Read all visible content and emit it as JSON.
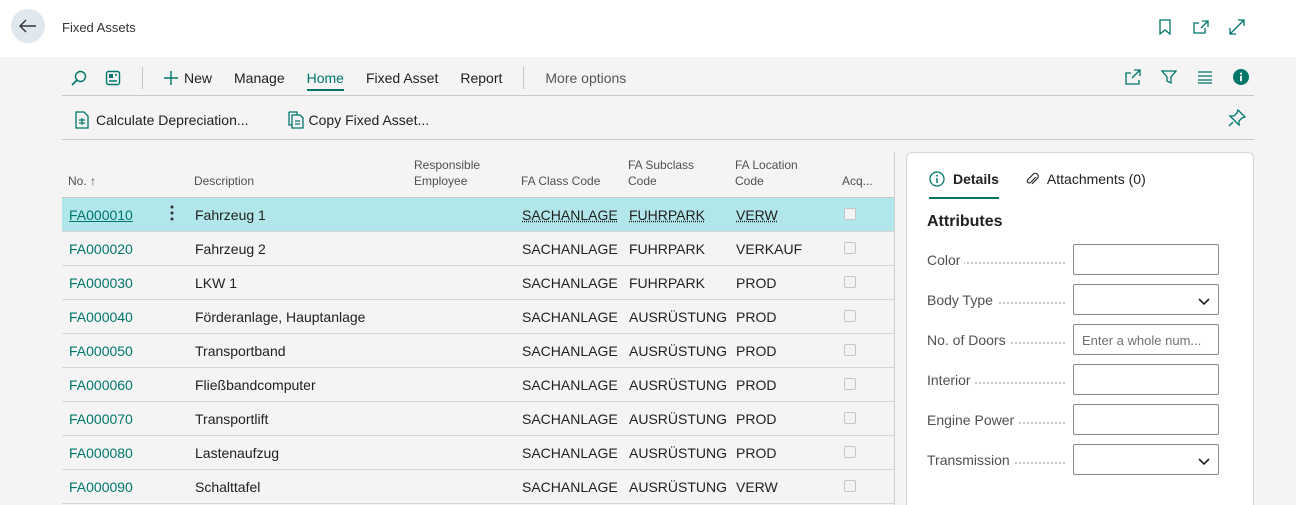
{
  "header": {
    "title": "Fixed Assets",
    "icons": [
      "back-arrow-icon",
      "bookmark-icon",
      "open-new-window-icon",
      "expand-icon"
    ]
  },
  "actionbar": {
    "items": [
      {
        "label": "New",
        "icon": "plus-icon"
      },
      {
        "label": "Manage"
      },
      {
        "label": "Home",
        "active": true
      },
      {
        "label": "Fixed Asset"
      },
      {
        "label": "Report"
      }
    ],
    "more_options": "More options",
    "right_icons": [
      "share-icon",
      "filter-icon",
      "list-view-icon",
      "info-icon"
    ]
  },
  "promoted": {
    "calc_depreciation": "Calculate Depreciation...",
    "copy_fixed_asset": "Copy Fixed Asset..."
  },
  "grid": {
    "headers": {
      "no": "No. ↑",
      "description": "Description",
      "responsible_1": "Responsible",
      "responsible_2": "Employee",
      "class": "FA Class Code",
      "subclass_1": "FA Subclass",
      "subclass_2": "Code",
      "location_1": "FA Location",
      "location_2": "Code",
      "acquired": "Acq..."
    },
    "rows": [
      {
        "no": "FA000010",
        "desc": "Fahrzeug 1",
        "cls": "SACHANLAGE",
        "sub": "FUHRPARK",
        "loc": "VERW",
        "selected": true
      },
      {
        "no": "FA000020",
        "desc": "Fahrzeug 2",
        "cls": "SACHANLAGE",
        "sub": "FUHRPARK",
        "loc": "VERKAUF"
      },
      {
        "no": "FA000030",
        "desc": "LKW 1",
        "cls": "SACHANLAGE",
        "sub": "FUHRPARK",
        "loc": "PROD"
      },
      {
        "no": "FA000040",
        "desc": "Förderanlage, Hauptanlage",
        "cls": "SACHANLAGE",
        "sub": "AUSRÜSTUNG",
        "loc": "PROD"
      },
      {
        "no": "FA000050",
        "desc": "Transportband",
        "cls": "SACHANLAGE",
        "sub": "AUSRÜSTUNG",
        "loc": "PROD"
      },
      {
        "no": "FA000060",
        "desc": "Fließbandcomputer",
        "cls": "SACHANLAGE",
        "sub": "AUSRÜSTUNG",
        "loc": "PROD"
      },
      {
        "no": "FA000070",
        "desc": "Transportlift",
        "cls": "SACHANLAGE",
        "sub": "AUSRÜSTUNG",
        "loc": "PROD"
      },
      {
        "no": "FA000080",
        "desc": "Lastenaufzug",
        "cls": "SACHANLAGE",
        "sub": "AUSRÜSTUNG",
        "loc": "PROD"
      },
      {
        "no": "FA000090",
        "desc": "Schalttafel",
        "cls": "SACHANLAGE",
        "sub": "AUSRÜSTUNG",
        "loc": "VERW"
      }
    ]
  },
  "factbox": {
    "tab_details": "Details",
    "tab_attachments": "Attachments (0)",
    "heading": "Attributes",
    "attributes": [
      {
        "label": "Color",
        "value": "",
        "type": "text"
      },
      {
        "label": "Body Type",
        "value": "",
        "type": "select"
      },
      {
        "label": "No. of Doors",
        "value": "",
        "placeholder": "Enter a whole num...",
        "type": "text"
      },
      {
        "label": "Interior",
        "value": "",
        "type": "text"
      },
      {
        "label": "Engine Power",
        "value": "",
        "type": "text"
      },
      {
        "label": "Transmission",
        "value": "",
        "type": "select"
      }
    ]
  },
  "colors": {
    "accent": "#00766b",
    "selected_row": "#b1e7ea",
    "background": "#f4f4f4"
  }
}
